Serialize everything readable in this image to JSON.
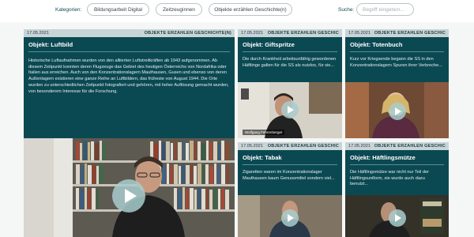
{
  "filters": {
    "label": "Kategorien:",
    "buttons": [
      "Bildungsarbeit Digital",
      "Zeitzeuginnen",
      "Objekte erzählen Geschichte(n)"
    ],
    "search_label": "Suche:",
    "search_placeholder": "Begriff eingeben..."
  },
  "cards": [
    {
      "date": "17.05.2021",
      "category": "OBJEKTE ERZÄHLEN GESCHICHTE(N)",
      "title": "Objekt: Luftbild",
      "text": "Historische Luftaufnahmen wurden von den alliierten Luftstreitkräften ab 1943 aufgenommen. Ab diesem Zeitpunkt konnten deren Flugzeuge das Gebiet des heutigen Österreichs von Nordafrika oder Italien aus erreichen. Auch von den Konzentrationslagern Mauthausen, Gusen und ebenso von deren Außenlagern existieren eine ganze Reihe an Luftbildern, das früheste von August 1944. Die Orte wurden zu unterschiedlichen Zeitpunkt fotografiert und gehören, mit hoher Auflösung gemacht wurden, von besonderem Interesse für die Forschung."
    },
    {
      "date": "17.05.2021",
      "category": "OBJEKTE ERZÄHLEN GESCHIC",
      "title": "Objekt: Giftspritze",
      "text": "Die durch Krankheit arbeitsunfähig gewordenen Häftlinge galten für die SS als nutzlos, für sie...",
      "name_tag": "Wolfgang Fehrenberger"
    },
    {
      "date": "17.05.2021",
      "category": "OBJEKTE ERZÄHLEN GESCHIC",
      "title": "Objekt: Totenbuch",
      "text": "Kurz vor Kriegsende begann die SS in den Konzentrationslagern Spuren ihrer Verbreche..."
    },
    {
      "date": "17.05.2021",
      "category": "OBJEKTE ERZÄHLEN GESCHIC",
      "title": "Objekt: Tabak",
      "text": "Zigaretten waren im Konzentrationslager Mauthausen kaum Genussmittel sondern viel..."
    },
    {
      "date": "17.05.2021",
      "category": "OBJEKTE ERZÄHLEN GESCHIC",
      "title": "Objekt: Häftlingsmütze",
      "text": "Die Häftlingsmütze war nicht nur Teil der Häftlingsuniform, sie wurde auch dazu benutzt..."
    }
  ],
  "colors": {
    "card_body": "#0b4952",
    "card_header": "#c8d5d7",
    "play_button": "#a8cdcd"
  },
  "icons": [
    "play-icon"
  ]
}
